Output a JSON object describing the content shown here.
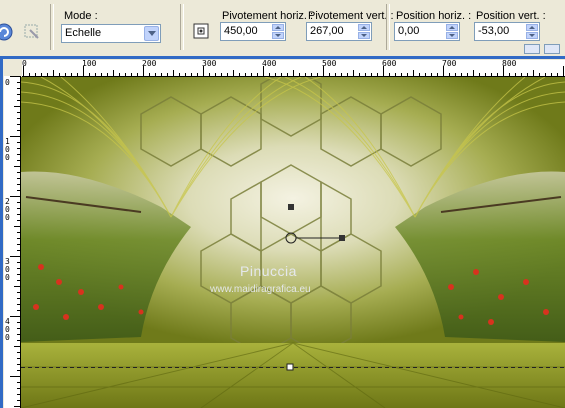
{
  "toolbar": {
    "mode_label": "Mode :",
    "mode_value": "Echelle",
    "pivot_h_label": "Pivotement horiz. :",
    "pivot_h_value": "450,00",
    "pivot_v_label": "Pivotement vert. :",
    "pivot_v_value": "267,00",
    "pos_h_label": "Position horiz. :",
    "pos_h_value": "0,00",
    "pos_v_label": "Position vert. :",
    "pos_v_value": "-53,00"
  },
  "ruler": {
    "top_labels": [
      "0",
      "100",
      "200",
      "300",
      "400",
      "500",
      "600",
      "700",
      "800"
    ],
    "left_labels": [
      "0",
      "1 0 0",
      "2 0 0",
      "3 0 0",
      "4 0 0"
    ]
  },
  "canvas": {
    "watermark_name": "Pinuccia",
    "watermark_url": "www.maidiragrafica.eu"
  },
  "colors": {
    "accent": "#316ac5",
    "olive": "#8a9a1c",
    "ruler_bg": "#ffffff",
    "toolbar_bg": "#ece9d8"
  }
}
